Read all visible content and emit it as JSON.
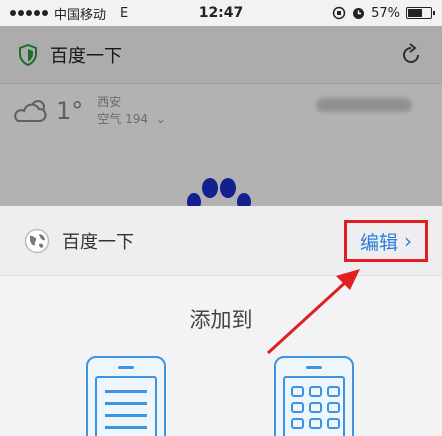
{
  "status_bar": {
    "carrier": "中国移动",
    "network": "E",
    "time": "12:47",
    "battery_percent": "57%",
    "battery_level": 0.57
  },
  "browser": {
    "title": "百度一下",
    "shield_icon": "shield-icon",
    "refresh_icon": "refresh-icon"
  },
  "page": {
    "weather": {
      "temperature": "1°",
      "city": "西安",
      "air_quality": "空气 194"
    }
  },
  "sheet": {
    "site_title": "百度一下",
    "edit_label": "编辑",
    "add_to_title": "添加到"
  },
  "colors": {
    "accent": "#2b7fd8",
    "highlight": "#e02020",
    "icon_blue": "#3c94e0"
  }
}
